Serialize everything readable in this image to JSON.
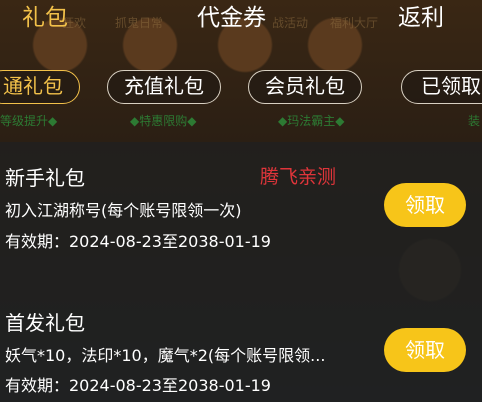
{
  "top_tabs": [
    {
      "label": "礼包",
      "active": true
    },
    {
      "label": "代金券",
      "active": false
    },
    {
      "label": "返利",
      "active": false
    }
  ],
  "background_texts": [
    "狂欢",
    "抓鬼日常",
    "战活动",
    "福利大厅"
  ],
  "background_green": [
    "等级提升◆",
    "◆特惠限购◆",
    "◆玛法霸主◆",
    "装"
  ],
  "sub_tabs": [
    {
      "label": "通礼包",
      "active": true
    },
    {
      "label": "充值礼包",
      "active": false
    },
    {
      "label": "会员礼包",
      "active": false
    },
    {
      "label": "已领取",
      "active": false
    }
  ],
  "watermark": "腾飞亲测",
  "gifts": [
    {
      "title": "新手礼包",
      "desc": "初入江湖称号(每个账号限领一次)",
      "valid": "有效期：2024-08-23至2038-01-19",
      "button": "领取"
    },
    {
      "title": "首发礼包",
      "desc": "妖气*10，法印*10，魔气*2(每个账号限领...",
      "valid": "有效期：2024-08-23至2038-01-19",
      "button": "领取"
    }
  ],
  "colors": {
    "accent": "#f2c14a",
    "button": "#f7c519",
    "watermark": "#e0353a",
    "panel": "#202020"
  }
}
